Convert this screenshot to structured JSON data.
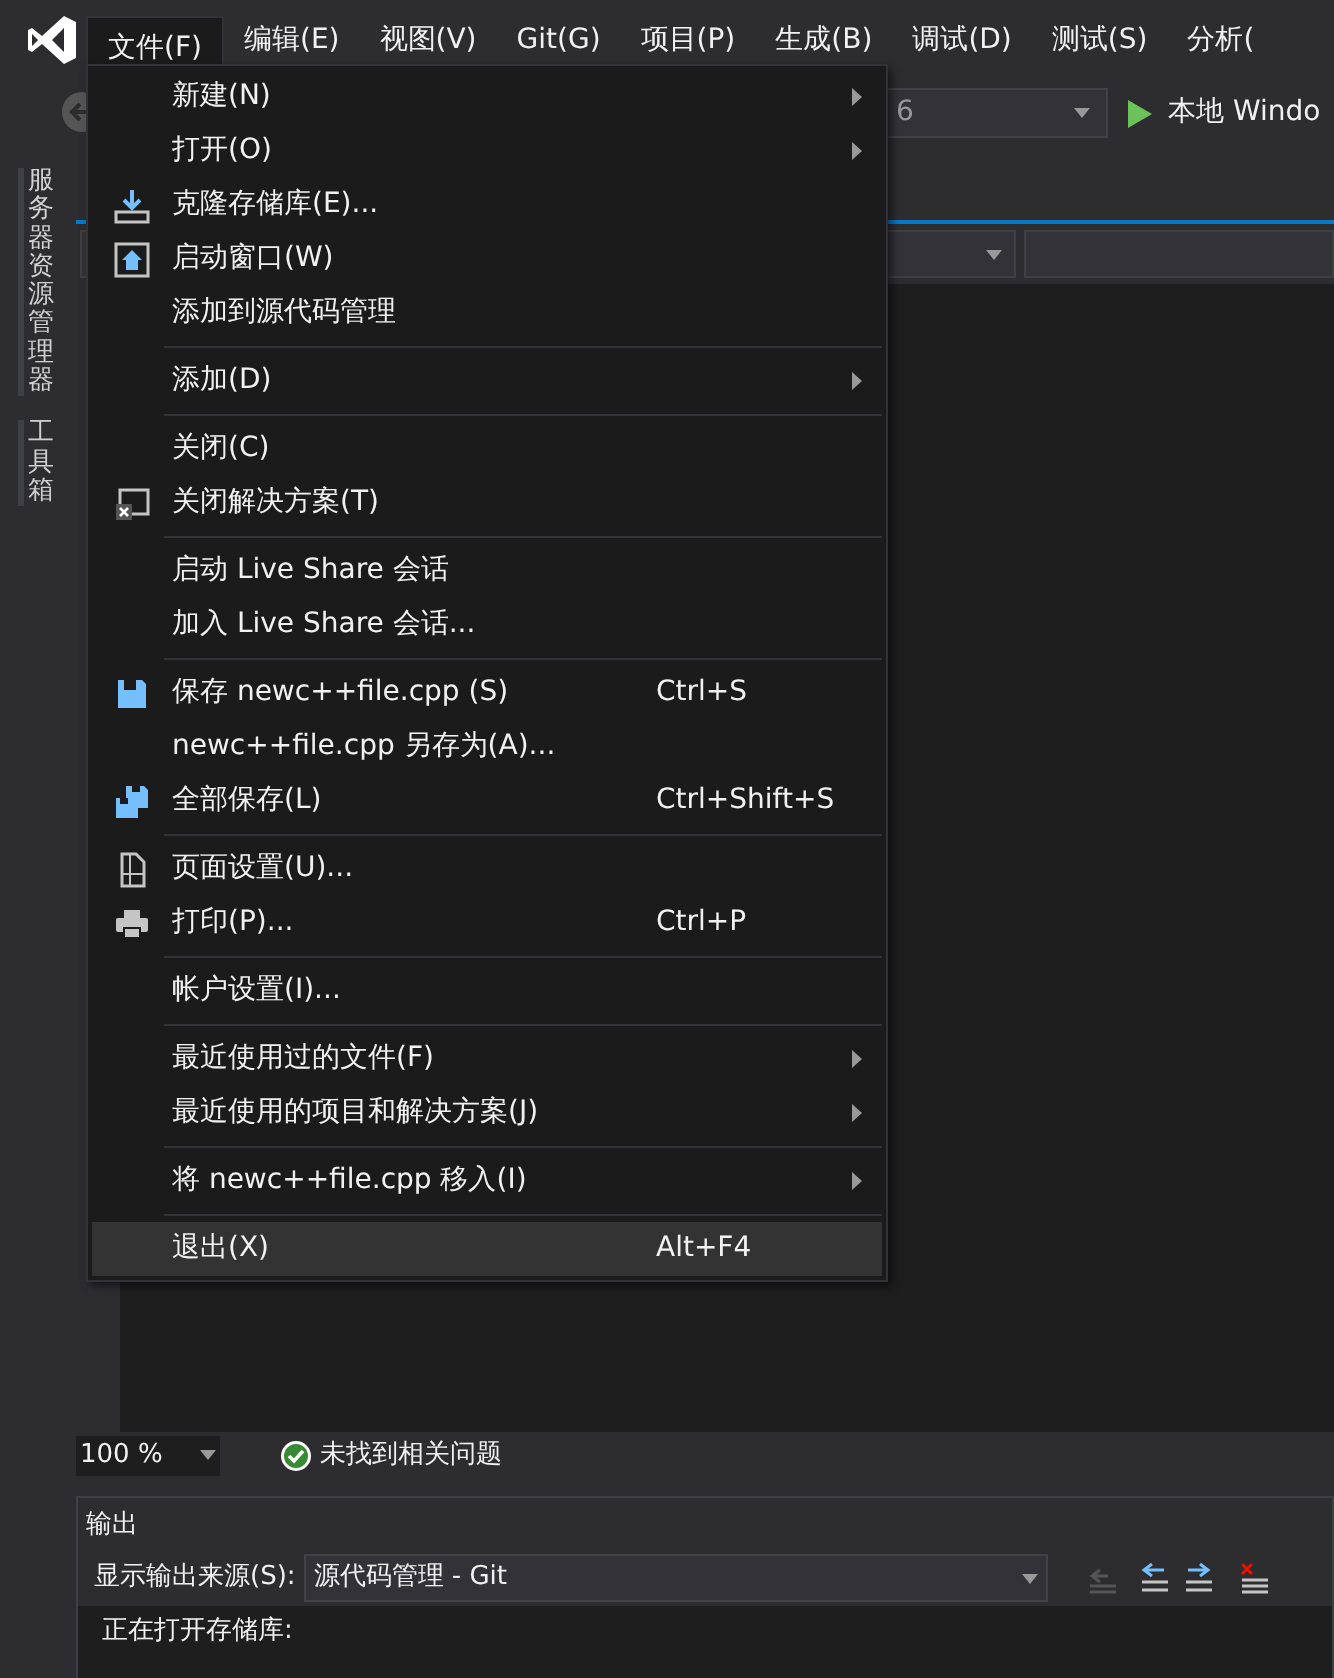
{
  "menu_bar": [
    {
      "label": "文件(F)",
      "selected": true
    },
    {
      "label": "编辑(E)",
      "selected": false
    },
    {
      "label": "视图(V)",
      "selected": false
    },
    {
      "label": "Git(G)",
      "selected": false
    },
    {
      "label": "项目(P)",
      "selected": false
    },
    {
      "label": "生成(B)",
      "selected": false
    },
    {
      "label": "调试(D)",
      "selected": false
    },
    {
      "label": "测试(S)",
      "selected": false
    },
    {
      "label": "分析(",
      "selected": false
    }
  ],
  "toolbar": {
    "config_value": "6",
    "run_label": "本地 Windo"
  },
  "side_tabs": [
    {
      "label": "服务器资源管理器"
    },
    {
      "label": "工具箱"
    }
  ],
  "file_menu": [
    {
      "kind": "item",
      "label": "新建(N)",
      "has_submenu": true,
      "selected": false
    },
    {
      "kind": "item",
      "label": "打开(O)",
      "has_submenu": true,
      "selected": false
    },
    {
      "kind": "item",
      "label": "克隆存储库(E)...",
      "has_submenu": false,
      "selected": false
    },
    {
      "kind": "item",
      "label": "启动窗口(W)",
      "has_submenu": false,
      "selected": false
    },
    {
      "kind": "item",
      "label": "添加到源代码管理",
      "has_submenu": false,
      "selected": false
    },
    {
      "kind": "separator"
    },
    {
      "kind": "item",
      "label": "添加(D)",
      "has_submenu": true,
      "selected": false
    },
    {
      "kind": "separator"
    },
    {
      "kind": "item",
      "label": "关闭(C)",
      "has_submenu": false,
      "selected": false
    },
    {
      "kind": "item",
      "label": "关闭解决方案(T)",
      "has_submenu": false,
      "selected": false
    },
    {
      "kind": "separator"
    },
    {
      "kind": "item",
      "label": "启动 Live Share 会话",
      "has_submenu": false,
      "selected": false
    },
    {
      "kind": "item",
      "label": "加入 Live Share 会话...",
      "has_submenu": false,
      "selected": false
    },
    {
      "kind": "separator"
    },
    {
      "kind": "item",
      "label": "保存 newc++file.cpp (S)",
      "shortcut": "Ctrl+S",
      "has_submenu": false,
      "selected": false
    },
    {
      "kind": "item",
      "label": "newc++file.cpp 另存为(A)...",
      "has_submenu": false,
      "selected": false
    },
    {
      "kind": "item",
      "label": "全部保存(L)",
      "shortcut": "Ctrl+Shift+S",
      "has_submenu": false,
      "selected": false
    },
    {
      "kind": "separator"
    },
    {
      "kind": "item",
      "label": "页面设置(U)...",
      "has_submenu": false,
      "selected": false
    },
    {
      "kind": "item",
      "label": "打印(P)...",
      "shortcut": "Ctrl+P",
      "has_submenu": false,
      "selected": false
    },
    {
      "kind": "separator"
    },
    {
      "kind": "item",
      "label": "帐户设置(I)...",
      "has_submenu": false,
      "selected": false
    },
    {
      "kind": "separator"
    },
    {
      "kind": "item",
      "label": "最近使用过的文件(F)",
      "has_submenu": true,
      "selected": false
    },
    {
      "kind": "item",
      "label": "最近使用的项目和解决方案(J)",
      "has_submenu": true,
      "selected": false
    },
    {
      "kind": "separator"
    },
    {
      "kind": "item",
      "label": "将 newc++file.cpp 移入(I)",
      "has_submenu": true,
      "selected": false
    },
    {
      "kind": "separator"
    },
    {
      "kind": "item",
      "label": "退出(X)",
      "shortcut": "Alt+F4",
      "has_submenu": false,
      "selected": true
    }
  ],
  "status_bar": {
    "zoom": "100 %",
    "issues": "未找到相关问题"
  },
  "output": {
    "title": "输出",
    "source_label": "显示输出来源(S):",
    "source_value": "源代码管理 - Git",
    "lines": [
      "正在打开存储库:"
    ]
  }
}
